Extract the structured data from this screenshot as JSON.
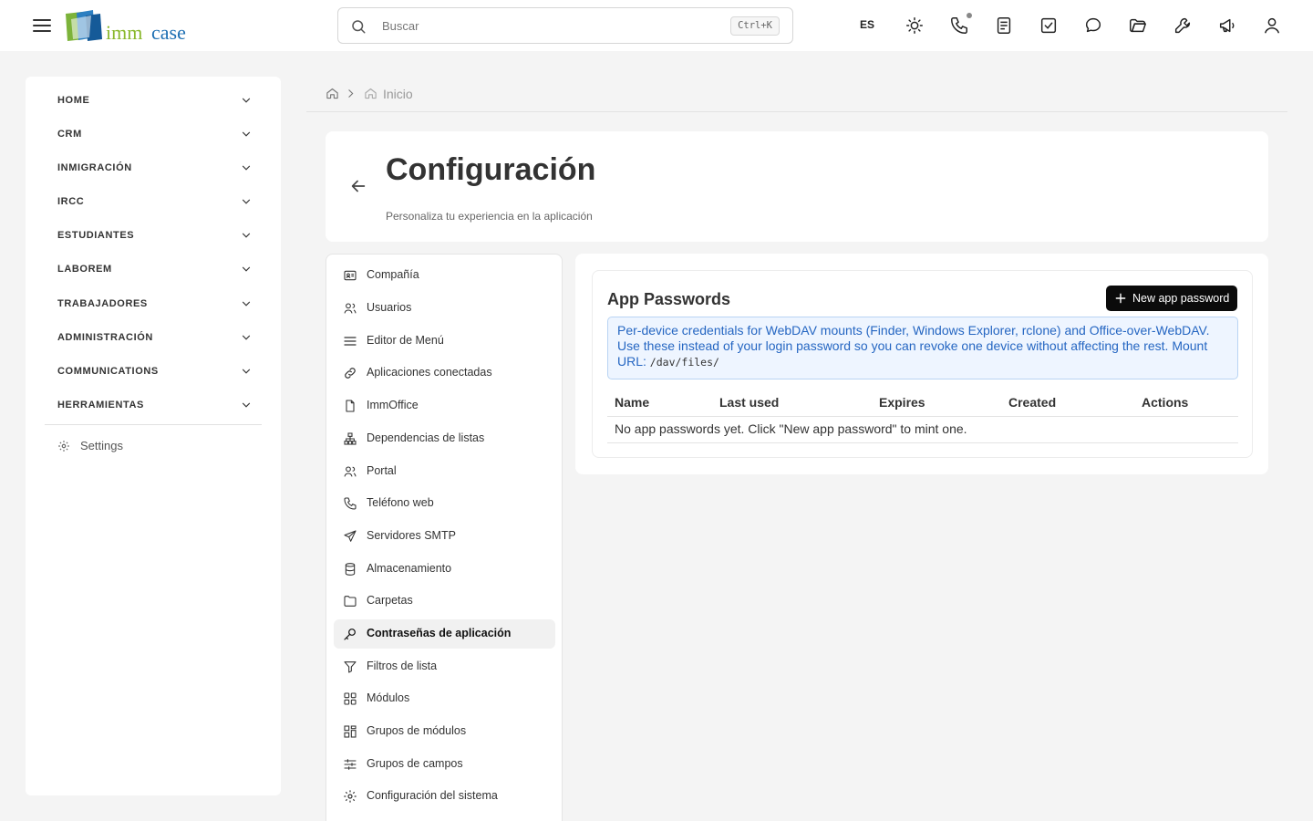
{
  "topbar": {
    "logo": {
      "text_left": "imm",
      "text_right": "case"
    },
    "search": {
      "placeholder": "Buscar",
      "shortcut": "Ctrl+K"
    },
    "language": "ES",
    "icons": [
      "sun-icon",
      "phone-icon",
      "notes-icon",
      "tasks-icon",
      "chat-icon",
      "folder-icon",
      "wrench-icon",
      "megaphone-icon",
      "user-icon"
    ]
  },
  "leftnav": {
    "items": [
      {
        "label": "HOME"
      },
      {
        "label": "CRM"
      },
      {
        "label": "INMIGRACIÓN"
      },
      {
        "label": "IRCC"
      },
      {
        "label": "ESTUDIANTES"
      },
      {
        "label": "LABOREM"
      },
      {
        "label": "TRABAJADORES"
      },
      {
        "label": "ADMINISTRACIÓN"
      },
      {
        "label": "COMMUNICATIONS"
      },
      {
        "label": "HERRAMIENTAS"
      }
    ],
    "settings_label": "Settings"
  },
  "breadcrumb": {
    "current": "Inicio"
  },
  "header": {
    "title": "Configuración",
    "subtitle": "Personaliza tu experiencia en la aplicación"
  },
  "settings_menu": {
    "items": [
      {
        "label": "Compañía",
        "icon": "id-card-icon"
      },
      {
        "label": "Usuarios",
        "icon": "users-icon"
      },
      {
        "label": "Editor de Menú",
        "icon": "menu-lines-icon"
      },
      {
        "label": "Aplicaciones conectadas",
        "icon": "link-icon"
      },
      {
        "label": "ImmOffice",
        "icon": "file-icon"
      },
      {
        "label": "Dependencias de listas",
        "icon": "hierarchy-icon"
      },
      {
        "label": "Portal",
        "icon": "users-icon"
      },
      {
        "label": "Teléfono web",
        "icon": "phone-icon"
      },
      {
        "label": "Servidores SMTP",
        "icon": "send-icon"
      },
      {
        "label": "Almacenamiento",
        "icon": "database-icon"
      },
      {
        "label": "Carpetas",
        "icon": "folder-icon"
      },
      {
        "label": "Contraseñas de aplicación",
        "icon": "key-icon",
        "active": true
      },
      {
        "label": "Filtros de lista",
        "icon": "filter-icon"
      },
      {
        "label": "Módulos",
        "icon": "grid-icon"
      },
      {
        "label": "Grupos de módulos",
        "icon": "grid-group-icon"
      },
      {
        "label": "Grupos de campos",
        "icon": "sliders-icon"
      },
      {
        "label": "Configuración del sistema",
        "icon": "gear-icon"
      }
    ]
  },
  "app_passwords": {
    "title": "App Passwords",
    "new_button": "New app password",
    "info_text": "Per-device credentials for WebDAV mounts (Finder, Windows Explorer, rclone) and Office-over-WebDAV. Use these instead of your login password so you can revoke one device without affecting the rest. Mount URL:",
    "mount_url": "/dav/files/",
    "columns": [
      "Name",
      "Last used",
      "Expires",
      "Created",
      "Actions"
    ],
    "empty_message": "No app passwords yet. Click \"New app password\" to mint one."
  },
  "colors": {
    "accent": "#0b0b0b",
    "info_text": "#2566c2",
    "info_bg": "#eef5ff",
    "logo_green": "#8ab82c",
    "logo_blue": "#1d6fb3"
  }
}
